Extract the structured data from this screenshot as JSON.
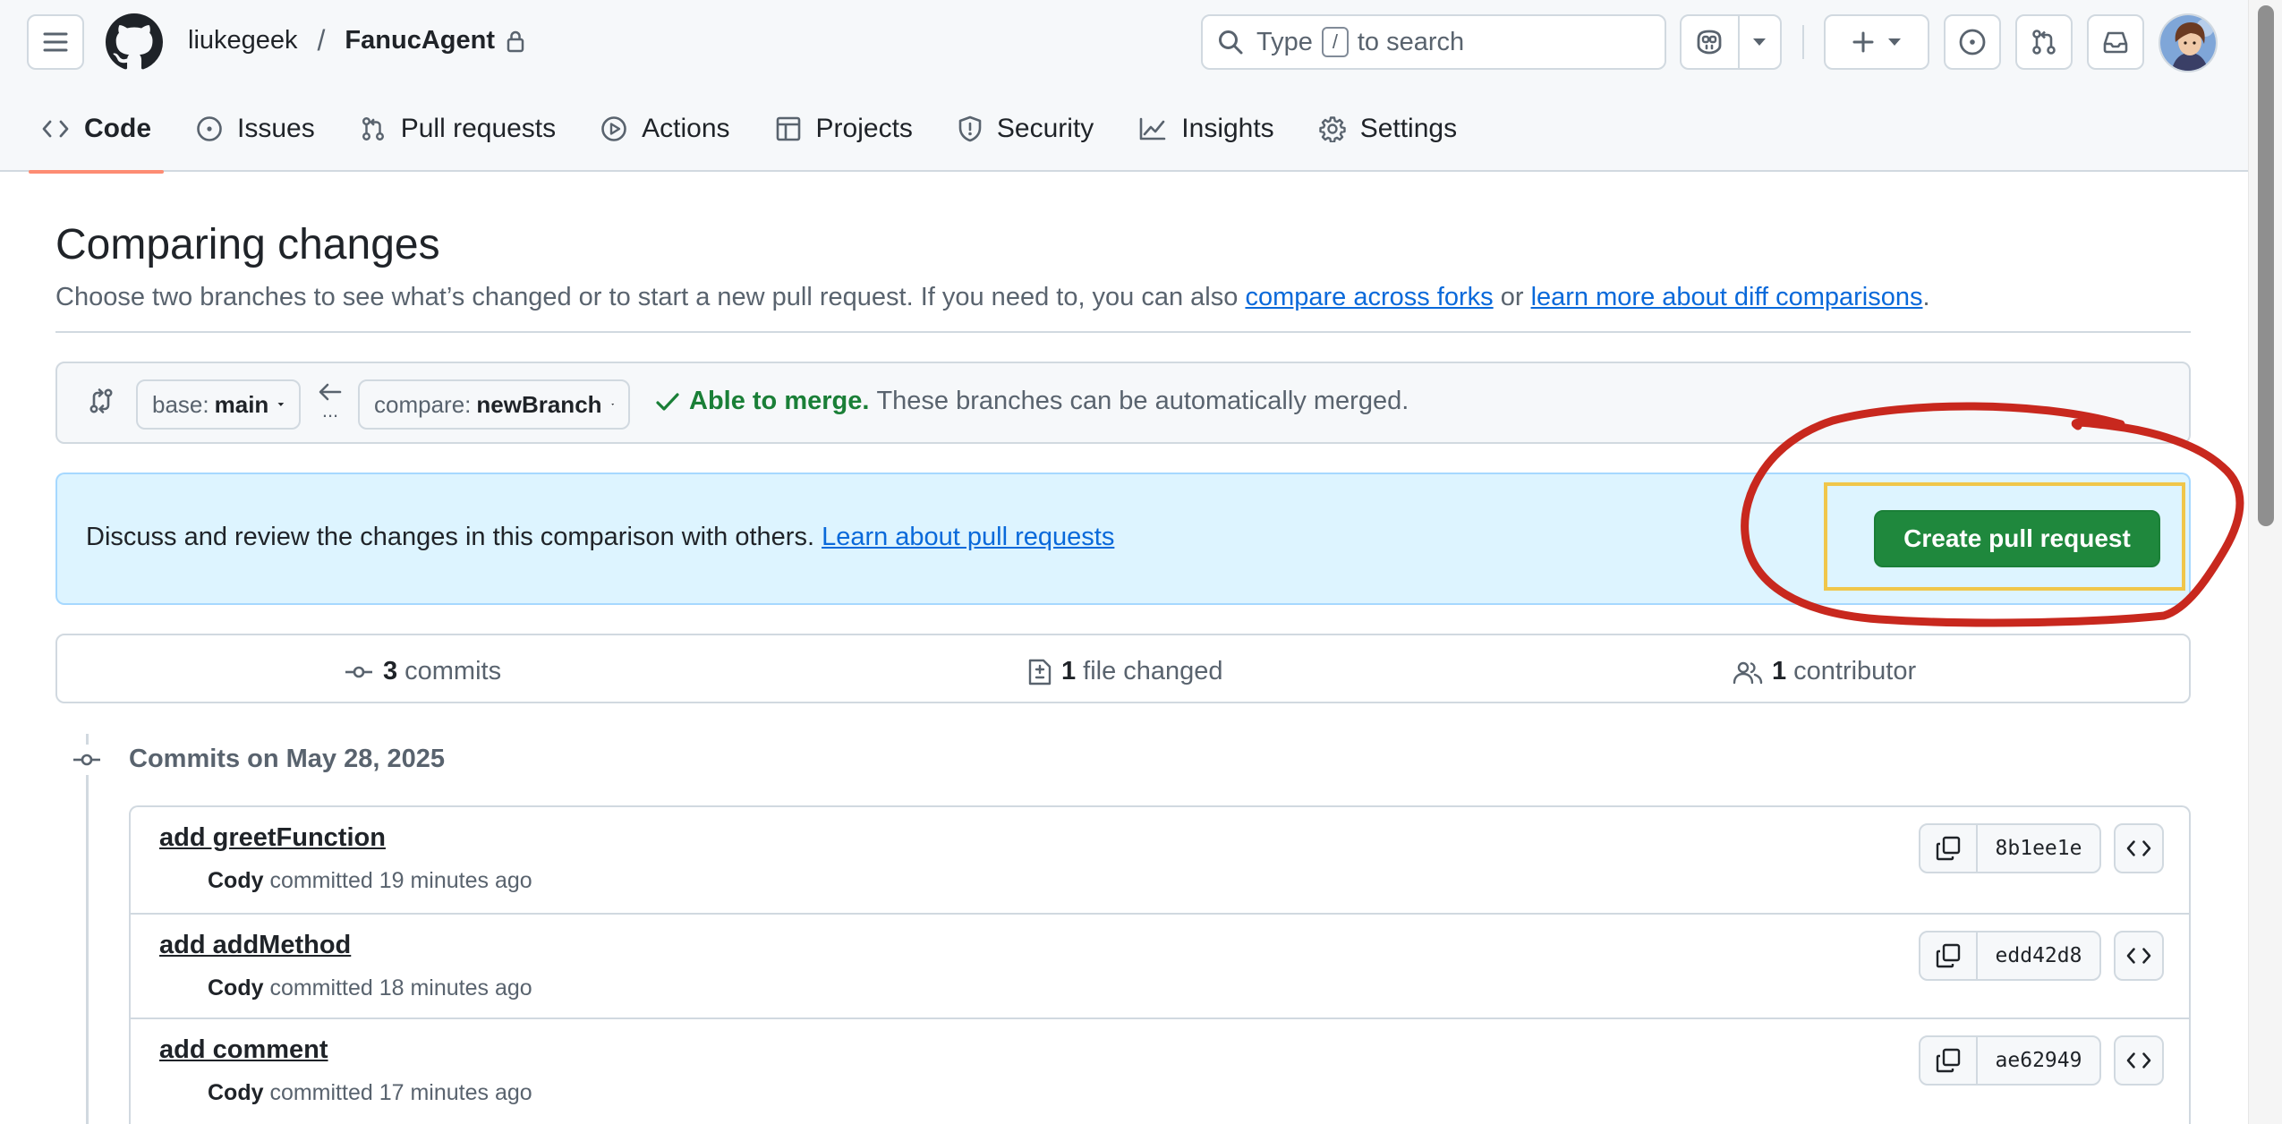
{
  "header": {
    "owner": "liukegeek",
    "separator": "/",
    "repo": "FanucAgent",
    "search": {
      "before": "Type",
      "key": "/",
      "after": "to search"
    }
  },
  "tabs": [
    {
      "label": "Code",
      "icon": "code-icon",
      "active": true
    },
    {
      "label": "Issues",
      "icon": "issue-opened-icon"
    },
    {
      "label": "Pull requests",
      "icon": "git-pull-request-icon"
    },
    {
      "label": "Actions",
      "icon": "play-icon"
    },
    {
      "label": "Projects",
      "icon": "table-icon"
    },
    {
      "label": "Security",
      "icon": "shield-icon"
    },
    {
      "label": "Insights",
      "icon": "graph-icon"
    },
    {
      "label": "Settings",
      "icon": "gear-icon"
    }
  ],
  "page": {
    "title": "Comparing changes",
    "desc_before": "Choose two branches to see what’s changed or to start a new pull request. If you need to, you can also",
    "link_forks": "compare across forks",
    "desc_or": "or",
    "link_learn": "learn more about diff comparisons",
    "desc_end": "."
  },
  "range": {
    "base_label": "base:",
    "base_branch": "main",
    "compare_label": "compare:",
    "compare_branch": "newBranch",
    "dots": "...",
    "status_ok": "Able to merge.",
    "status_text": "These branches can be automatically merged."
  },
  "flash": {
    "message": "Discuss and review the changes in this comparison with others.",
    "link": "Learn about pull requests",
    "button": "Create pull request"
  },
  "summary": {
    "commits_count": "3",
    "commits_label": "commits",
    "files_count": "1",
    "files_label": "file changed",
    "contributors_count": "1",
    "contributors_label": "contributor"
  },
  "commits": {
    "date_heading": "Commits on May 28, 2025",
    "items": [
      {
        "title": "add greetFunction",
        "author": "Cody",
        "action": "committed 19 minutes ago",
        "sha": "8b1ee1e"
      },
      {
        "title": "add addMethod",
        "author": "Cody",
        "action": "committed 18 minutes ago",
        "sha": "edd42d8"
      },
      {
        "title": "add comment",
        "author": "Cody",
        "action": "committed 17 minutes ago",
        "sha": "ae62949"
      }
    ]
  },
  "colors": {
    "accent_green": "#1f883d",
    "link_blue": "#0969da",
    "flash_bg": "#ddf4ff",
    "annotation_red": "#c8281e",
    "highlight_yellow": "#f0c64a",
    "tab_underline": "#fd8c73"
  }
}
